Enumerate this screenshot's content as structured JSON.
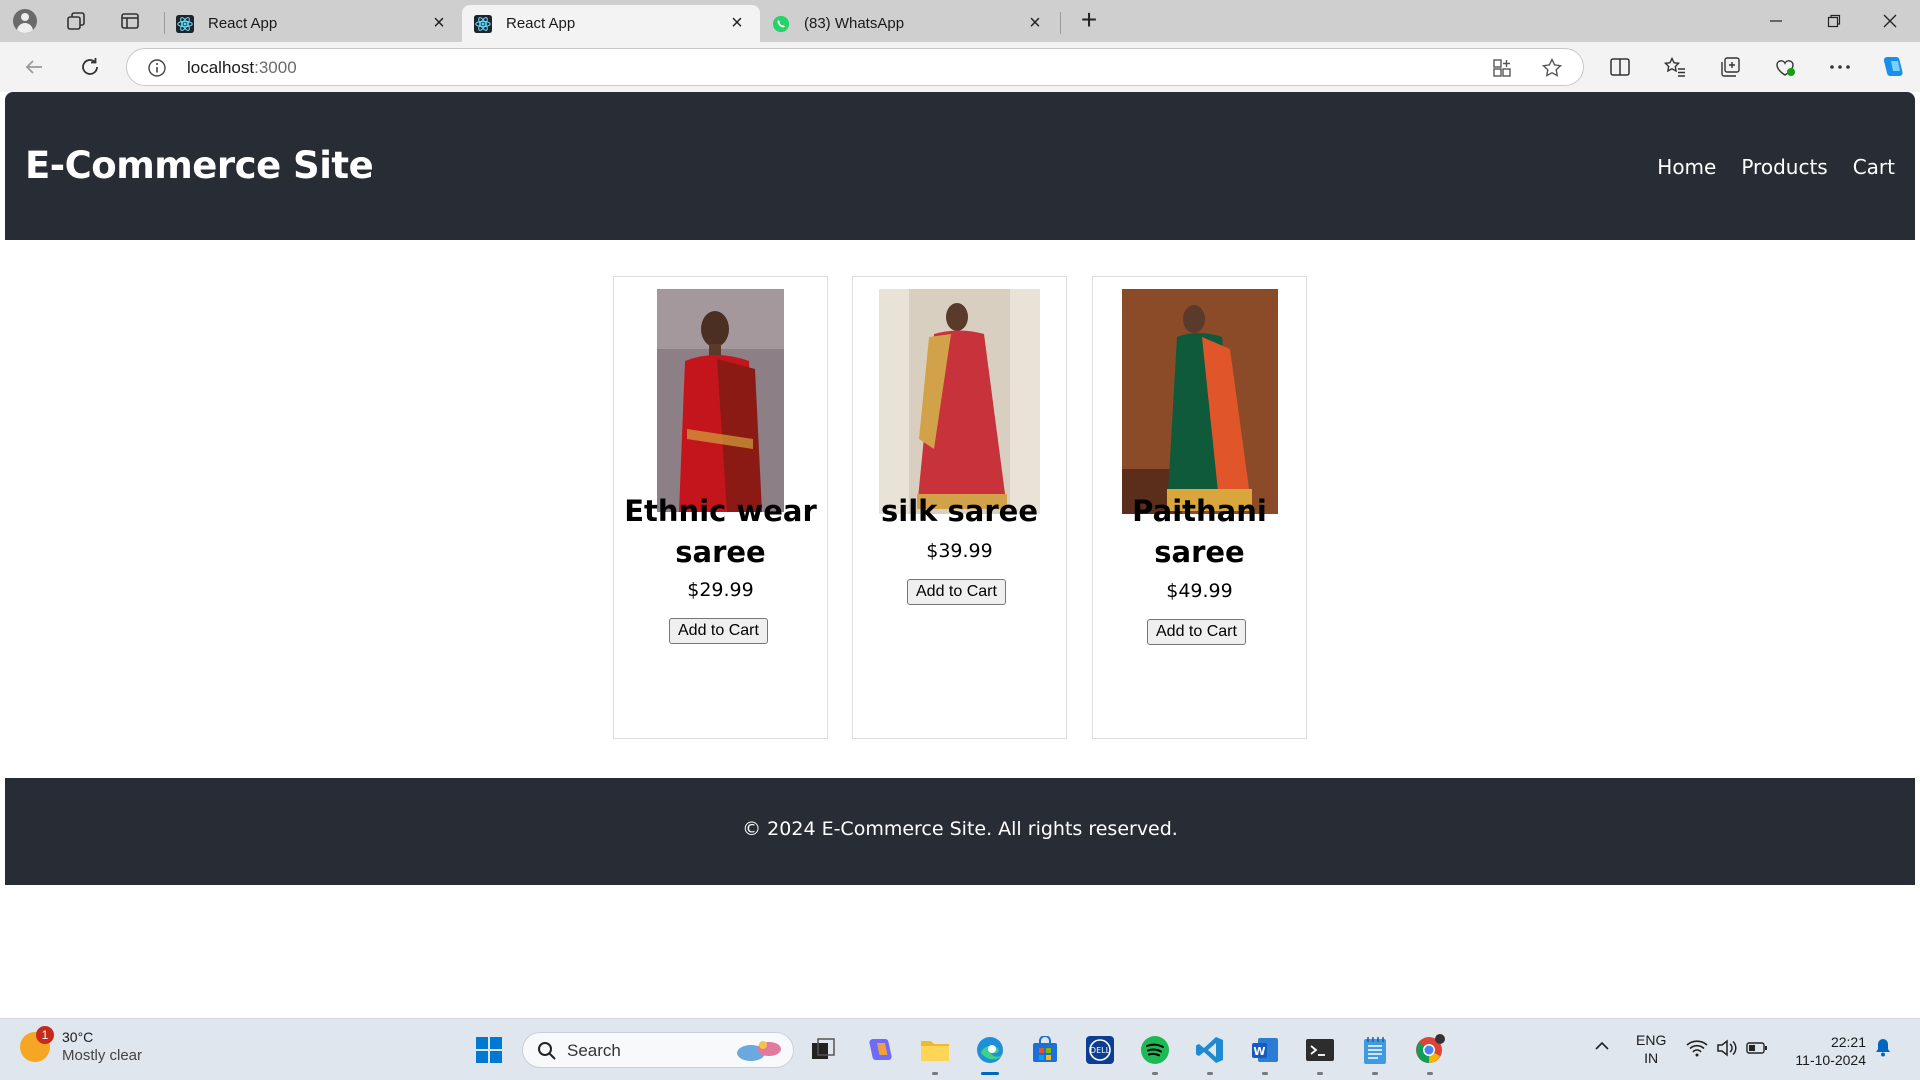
{
  "browser": {
    "tabs": [
      {
        "title": "React App",
        "active": false
      },
      {
        "title": "React App",
        "active": true
      },
      {
        "title": "(83) WhatsApp",
        "active": false
      }
    ],
    "address": {
      "host": "localhost",
      "port": ":3000"
    }
  },
  "site": {
    "title": "E-Commerce Site",
    "nav": [
      {
        "label": "Home"
      },
      {
        "label": "Products"
      },
      {
        "label": "Cart"
      }
    ],
    "products": [
      {
        "name": "Ethnic wear saree",
        "price": "$29.99",
        "button": "Add to Cart",
        "saree_color": "#c4151c",
        "pallu_color": "#8b1a14",
        "bg_color": "#8d7f86"
      },
      {
        "name": "silk saree",
        "price": "$39.99",
        "button": "Add to Cart",
        "saree_color": "#c8323a",
        "pallu_color": "#d2a24a",
        "bg_color": "#d9cfc0"
      },
      {
        "name": "Paithani saree",
        "price": "$49.99",
        "button": "Add to Cart",
        "saree_color": "#0f5a3a",
        "pallu_color": "#e0562a",
        "bg_color": "#8b4a28"
      }
    ],
    "footer": "© 2024 E-Commerce Site. All rights reserved."
  },
  "colors": {
    "header_bg": "#282c34",
    "accent": "#0067c0"
  },
  "taskbar": {
    "weather": {
      "temp": "30°C",
      "desc": "Mostly clear",
      "badge": "1"
    },
    "search_label": "Search",
    "lang": {
      "line1": "ENG",
      "line2": "IN"
    },
    "clock": {
      "time": "22:21",
      "date": "11-10-2024"
    }
  }
}
